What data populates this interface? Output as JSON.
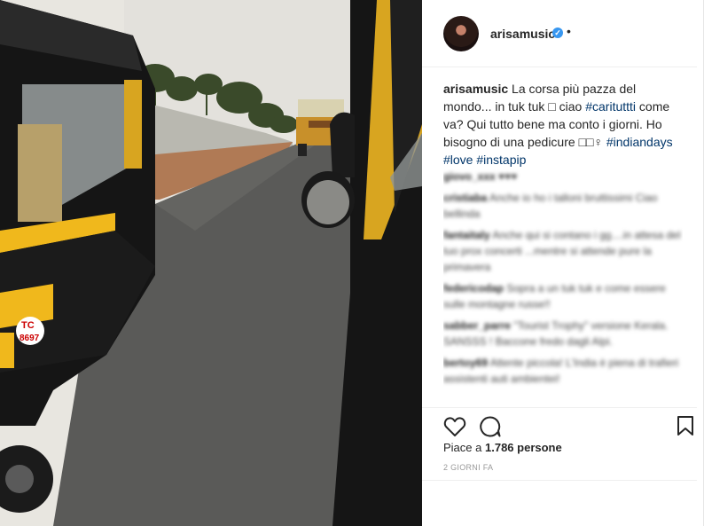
{
  "post": {
    "username": "arisamusic",
    "more_dot": "•",
    "caption_username": "arisamusic",
    "caption_text_1": " La corsa più pazza del mondo... in tuk tuk ",
    "caption_text_2": " ciao ",
    "caption_tag_1": "#carituttti",
    "caption_text_3": " come va? Qui tutto bene ma conto i giorni. Ho bisogno di una pedicure ",
    "caption_text_4": " ",
    "caption_tag_2": "#indiandays",
    "caption_tag_3": "#love",
    "caption_tag_4": "#instapip",
    "likes_label": "Piace a",
    "likes_count": "1.786 persone",
    "date": "2 GIORNI FA"
  },
  "comments": [
    {
      "user": "giovo_xxx",
      "text": "♥♥♥"
    },
    {
      "user": "cristiaba",
      "text": "Anche io ho i talloni bruttissimi Ciao bellinda"
    },
    {
      "user": "fantaitaly",
      "text": "Anche qui si contano i gg....in attesa del tuo prox concerti ...mentre si attende pure la primavera"
    },
    {
      "user": "federicodap",
      "text": "Sopra a un tuk tuk e come essere sulle montagne russe!!"
    },
    {
      "user": "sabber_parre",
      "text": "\"Tourist Trophy\" versione Kerala. SANSSS ! Baccone fredo dagli Alpi."
    },
    {
      "user": "bertoy69",
      "text": "Attente piccola! L'India è piena di trafieri assistenti auti ambientei!"
    }
  ],
  "colors": {
    "hashtag": "#003569",
    "verified": "#3897f0"
  },
  "icons": [
    "heart-icon",
    "comment-icon",
    "bookmark-icon",
    "verified-icon"
  ]
}
